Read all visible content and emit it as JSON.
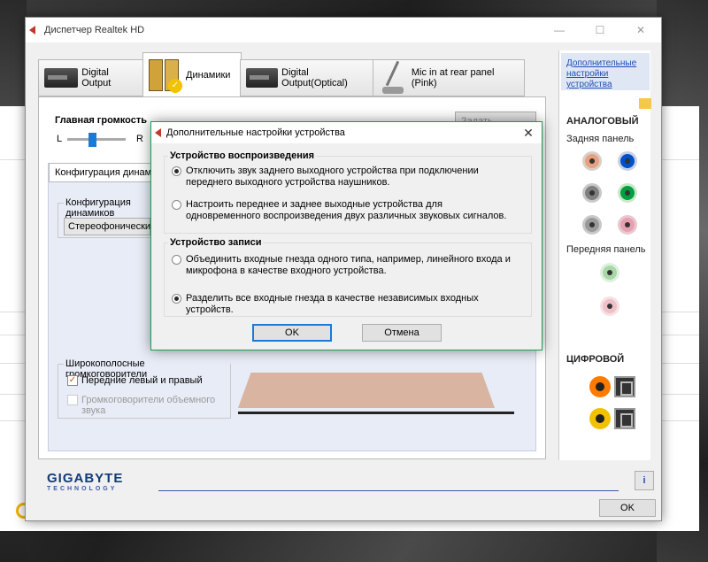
{
  "window": {
    "title": "Диспетчер Realtek HD",
    "controls": [
      "—",
      "☐",
      "✕"
    ]
  },
  "tabs": [
    {
      "label": "Digital Output"
    },
    {
      "label": "Динамики"
    },
    {
      "label": "Digital Output(Optical)"
    },
    {
      "label": "Mic in at rear panel (Pink)"
    }
  ],
  "main_volume": {
    "label": "Главная громкость",
    "left": "L",
    "right": "R",
    "level": 0.45
  },
  "default_button": "Задать...",
  "speaker_config": {
    "tab_label": "Конфигурация динамиков",
    "group_label": "Конфигурация динамиков",
    "selected": "Стереофонический"
  },
  "fullrange": {
    "group_label": "Широкополосные громкоговорители",
    "front_label": "Передние левый и правый",
    "front_checked": true,
    "surround_label": "Громкоговорители объемного звука",
    "surround_checked": false
  },
  "right_pane": {
    "advanced_link": "Дополнительные настройки устройства",
    "analog_title": "АНАЛОГОВЫЙ",
    "rear_panel": "Задняя панель",
    "front_panel": "Передняя панель",
    "digital_title": "ЦИФРОВОЙ",
    "rear_jacks": [
      "#e8a080",
      "#0050c8",
      "#808080",
      "#00a040",
      "#9a9a9a",
      "#e8a0b0"
    ],
    "front_jacks": [
      "#a8d8a8",
      "#f0c0c8"
    ],
    "digital_colors": [
      "#ff7a00",
      "#f2c200"
    ]
  },
  "footer": {
    "brand": "GIGABYTE",
    "brand_sub": "TECHNOLOGY",
    "info": "i",
    "ok": "OK"
  },
  "dialog": {
    "title": "Дополнительные настройки устройства",
    "playback_title": "Устройство воспроизведения",
    "playback_opt1": "Отключить звук заднего выходного устройства при подключении переднего выходного устройства наушников.",
    "playback_opt2": "Настроить переднее и заднее выходные устройства для одновременного воспроизведения двух различных звуковых сигналов.",
    "record_title": "Устройство записи",
    "record_opt1": "Объединить входные гнезда одного типа, например, линейного входа и микрофона в качестве входного устройства.",
    "record_opt2": "Разделить все входные гнезда в качестве независимых входных устройств.",
    "ok": "OK",
    "cancel": "Отмена"
  }
}
